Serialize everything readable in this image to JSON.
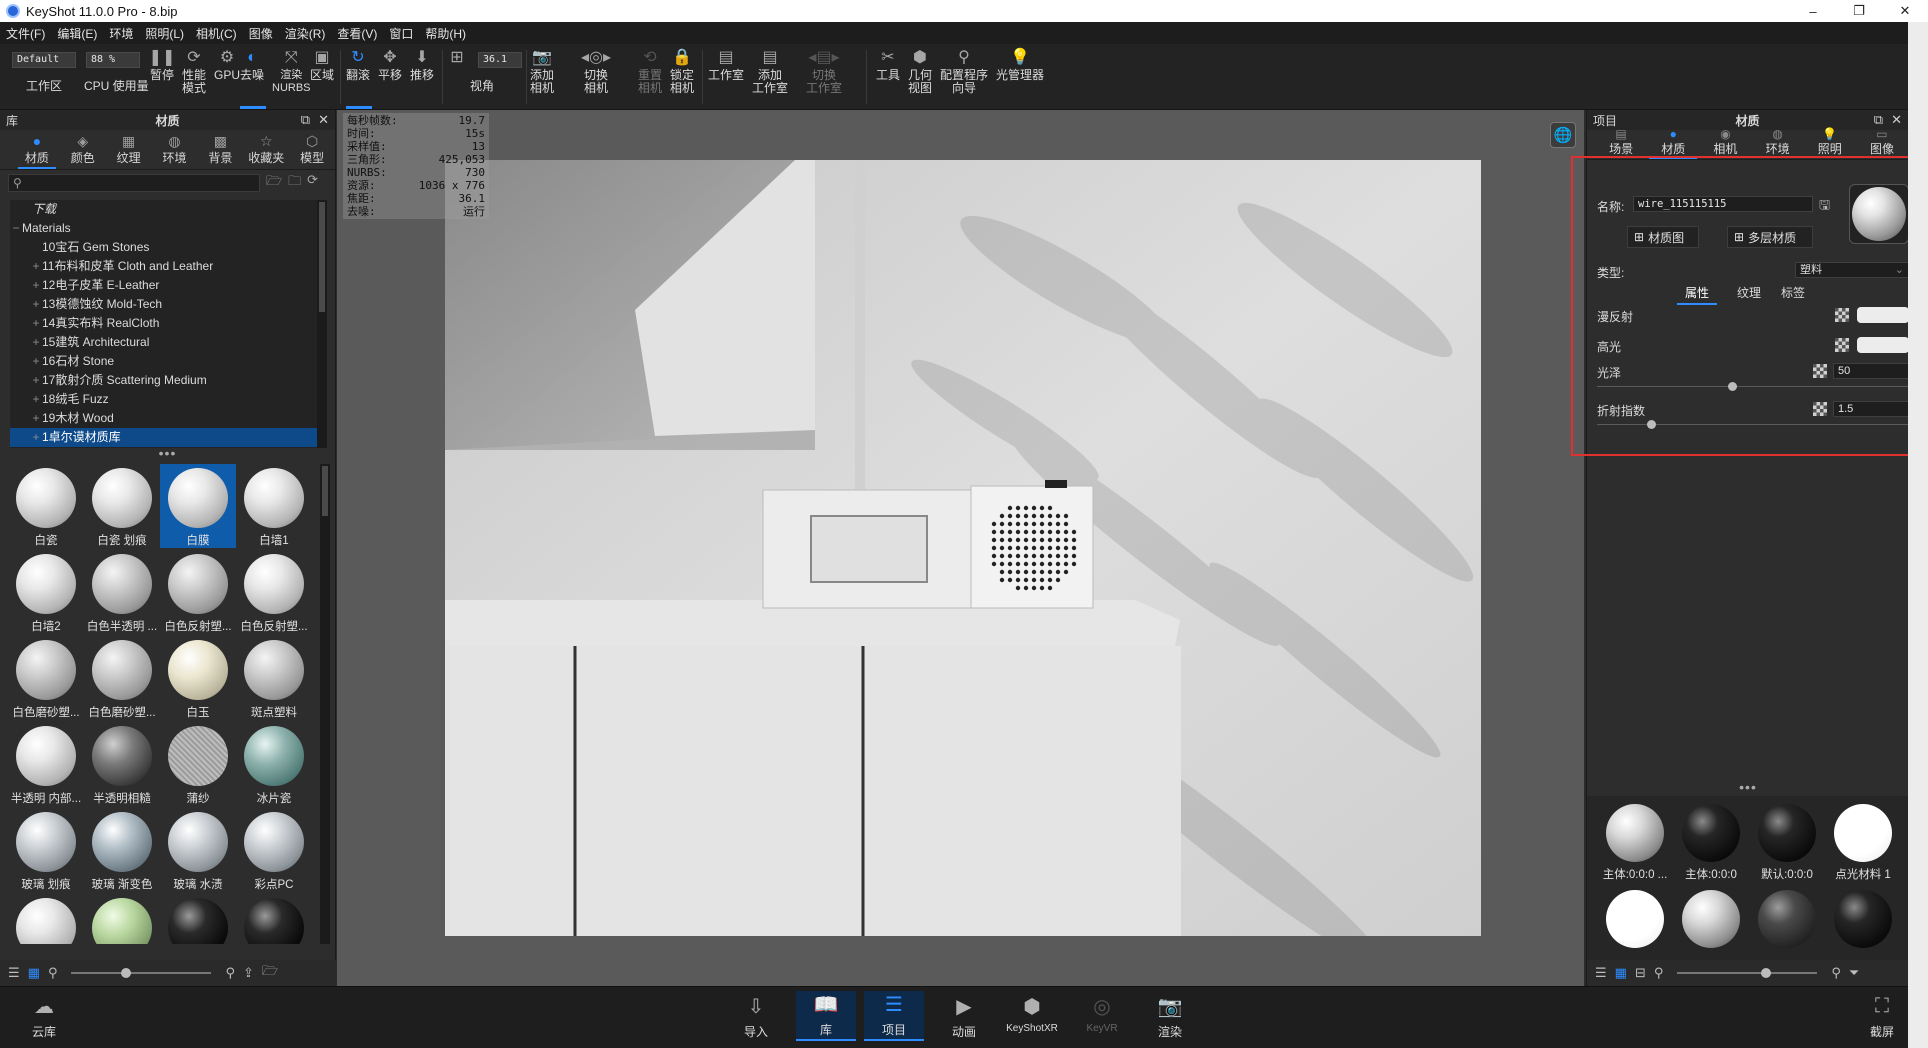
{
  "window": {
    "title": "KeyShot 11.0.0 Pro  - 8.bip",
    "min": "–",
    "max": "❐",
    "close": "✕"
  },
  "menu": [
    "文件(F)",
    "编辑(E)",
    "环境",
    "照明(L)",
    "相机(C)",
    "图像",
    "渲染(R)",
    "查看(V)",
    "窗口",
    "帮助(H)"
  ],
  "toolbar": {
    "workspace_value": "Default",
    "workspace_label": "工作区",
    "cpu_percent": "88 %",
    "cpu_label": "CPU 使用量",
    "pause": "暂停",
    "perf": "性能\n模式",
    "gpu": "GPU",
    "denoise": "去噪",
    "nurbs": "渲染\nNURBS",
    "region": "区域",
    "tumble": "翻滚",
    "pan": "平移",
    "dolly": "推移",
    "fov_value": "36.1",
    "fov_label": "视角",
    "add_camera": "添加\n相机",
    "switch_camera": "切换\n相机",
    "reset_camera": "重置\n相机",
    "lock_camera": "锁定\n相机",
    "studio": "工作室",
    "add_studio": "添加\n工作室",
    "switch_studio": "切换\n工作室",
    "tools": "工具",
    "geometry_view": "几何\n视图",
    "config_wizard": "配置程序\n向导",
    "light_manager": "光管理器"
  },
  "library": {
    "title": "库",
    "panel_title": "材质",
    "tabs": [
      {
        "label": "材质",
        "icon": "material-icon"
      },
      {
        "label": "颜色",
        "icon": "color-icon"
      },
      {
        "label": "纹理",
        "icon": "texture-icon"
      },
      {
        "label": "环境",
        "icon": "environment-icon"
      },
      {
        "label": "背景",
        "icon": "background-icon"
      },
      {
        "label": "收藏夹",
        "icon": "favorites-icon"
      },
      {
        "label": "模型",
        "icon": "model-icon"
      }
    ],
    "tree": [
      {
        "label": "下载",
        "indent": 1,
        "italic": true
      },
      {
        "label": "Materials",
        "indent": 0,
        "exp": "−"
      },
      {
        "label": "10宝石 Gem Stones",
        "indent": 2
      },
      {
        "label": "11布料和皮革 Cloth and Leather",
        "indent": 2,
        "exp": "+"
      },
      {
        "label": "12电子皮革 E-Leather",
        "indent": 2,
        "exp": "+"
      },
      {
        "label": "13模德蚀纹 Mold-Tech",
        "indent": 2,
        "exp": "+"
      },
      {
        "label": "14真实布料 RealCloth",
        "indent": 2,
        "exp": "+"
      },
      {
        "label": "15建筑 Architectural",
        "indent": 2,
        "exp": "+"
      },
      {
        "label": "16石材 Stone",
        "indent": 2,
        "exp": "+"
      },
      {
        "label": "17散射介质 Scattering Medium",
        "indent": 2,
        "exp": "+"
      },
      {
        "label": "18绒毛 Fuzz",
        "indent": 2,
        "exp": "+"
      },
      {
        "label": "19木材 Wood",
        "indent": 2,
        "exp": "+"
      },
      {
        "label": "1卓尔谟材质库",
        "indent": 2,
        "exp": "+",
        "selected": true
      }
    ],
    "materials": [
      {
        "label": "白瓷",
        "tone": "light"
      },
      {
        "label": "白瓷 划痕",
        "tone": "light"
      },
      {
        "label": "白膜",
        "tone": "light",
        "selected": true
      },
      {
        "label": "白墙1",
        "tone": "light"
      },
      {
        "label": "白墙2",
        "tone": "light"
      },
      {
        "label": "白色半透明 ...",
        "tone": "grey"
      },
      {
        "label": "白色反射塑...",
        "tone": "grey"
      },
      {
        "label": "白色反射塑...",
        "tone": "light"
      },
      {
        "label": "白色磨砂塑...",
        "tone": "grey"
      },
      {
        "label": "白色磨砂塑...",
        "tone": "grey"
      },
      {
        "label": "白玉",
        "tone": "cream"
      },
      {
        "label": "斑点塑料",
        "tone": "grey"
      },
      {
        "label": "半透明 内部...",
        "tone": "light"
      },
      {
        "label": "半透明相糙",
        "tone": "dark"
      },
      {
        "label": "蒲纱",
        "tone": "mesh"
      },
      {
        "label": "冰片瓷",
        "tone": "teal"
      },
      {
        "label": "玻璃 划痕",
        "tone": "glass"
      },
      {
        "label": "玻璃 渐变色",
        "tone": "glassblue"
      },
      {
        "label": "玻璃 水渍",
        "tone": "glass"
      },
      {
        "label": "彩点PC",
        "tone": "glass"
      },
      {
        "label": "",
        "tone": "light"
      },
      {
        "label": "",
        "tone": "green"
      },
      {
        "label": "",
        "tone": "black"
      },
      {
        "label": "",
        "tone": "black"
      }
    ]
  },
  "viewport": {
    "stats": [
      {
        "k": "每秒帧数:",
        "v": "19.7"
      },
      {
        "k": "时间:",
        "v": "15s"
      },
      {
        "k": "采样值:",
        "v": "13"
      },
      {
        "k": "三角形:",
        "v": "425,053"
      },
      {
        "k": "NURBS:",
        "v": "730"
      },
      {
        "k": "资源:",
        "v": "1036 x 776"
      },
      {
        "k": "焦距:",
        "v": "36.1"
      },
      {
        "k": "去噪:",
        "v": "运行"
      }
    ]
  },
  "project": {
    "title": "项目",
    "panel_title": "材质",
    "tabs": [
      {
        "label": "场景",
        "icon": "scene-icon"
      },
      {
        "label": "材质",
        "icon": "material-icon"
      },
      {
        "label": "相机",
        "icon": "camera-icon"
      },
      {
        "label": "环境",
        "icon": "environment-icon"
      },
      {
        "label": "照明",
        "icon": "lighting-icon"
      },
      {
        "label": "图像",
        "icon": "image-icon"
      }
    ],
    "name_label": "名称:",
    "name_value": "wire_115115115",
    "material_graph_btn": "材质图",
    "multilayer_btn": "多层材质",
    "type_label": "类型:",
    "type_value": "塑料",
    "subtabs": [
      "属性",
      "纹理",
      "标签"
    ],
    "diffuse_label": "漫反射",
    "specular_label": "高光",
    "gloss_label": "光泽",
    "gloss_value": "50",
    "gloss_fraction": 0.42,
    "ior_label": "折射指数",
    "ior_value": "1.5",
    "ior_fraction": 0.2,
    "scene_materials": [
      {
        "label": "主体:0:0:0 ...",
        "tone": "silver"
      },
      {
        "label": "主体:0:0:0",
        "tone": "blackgloss"
      },
      {
        "label": "默认:0:0:0",
        "tone": "blackgloss"
      },
      {
        "label": "点光材料 1",
        "tone": "white"
      },
      {
        "label": "",
        "tone": "white"
      },
      {
        "label": "",
        "tone": "silver"
      },
      {
        "label": "",
        "tone": "darkgrey"
      },
      {
        "label": "",
        "tone": "blackgloss"
      }
    ]
  },
  "dock": [
    {
      "label": "云库",
      "icon": "cloud-library-icon"
    },
    {
      "label": "导入",
      "icon": "import-icon"
    },
    {
      "label": "库",
      "icon": "library-icon",
      "active": true
    },
    {
      "label": "项目",
      "icon": "project-icon",
      "active": true
    },
    {
      "label": "动画",
      "icon": "animation-icon"
    },
    {
      "label": "KeyShotXR",
      "icon": "keyshotxr-icon"
    },
    {
      "label": "KeyVR",
      "icon": "keyvr-icon",
      "disabled": true
    },
    {
      "label": "渲染",
      "icon": "render-icon"
    },
    {
      "label": "截屏",
      "icon": "screenshot-icon"
    }
  ]
}
